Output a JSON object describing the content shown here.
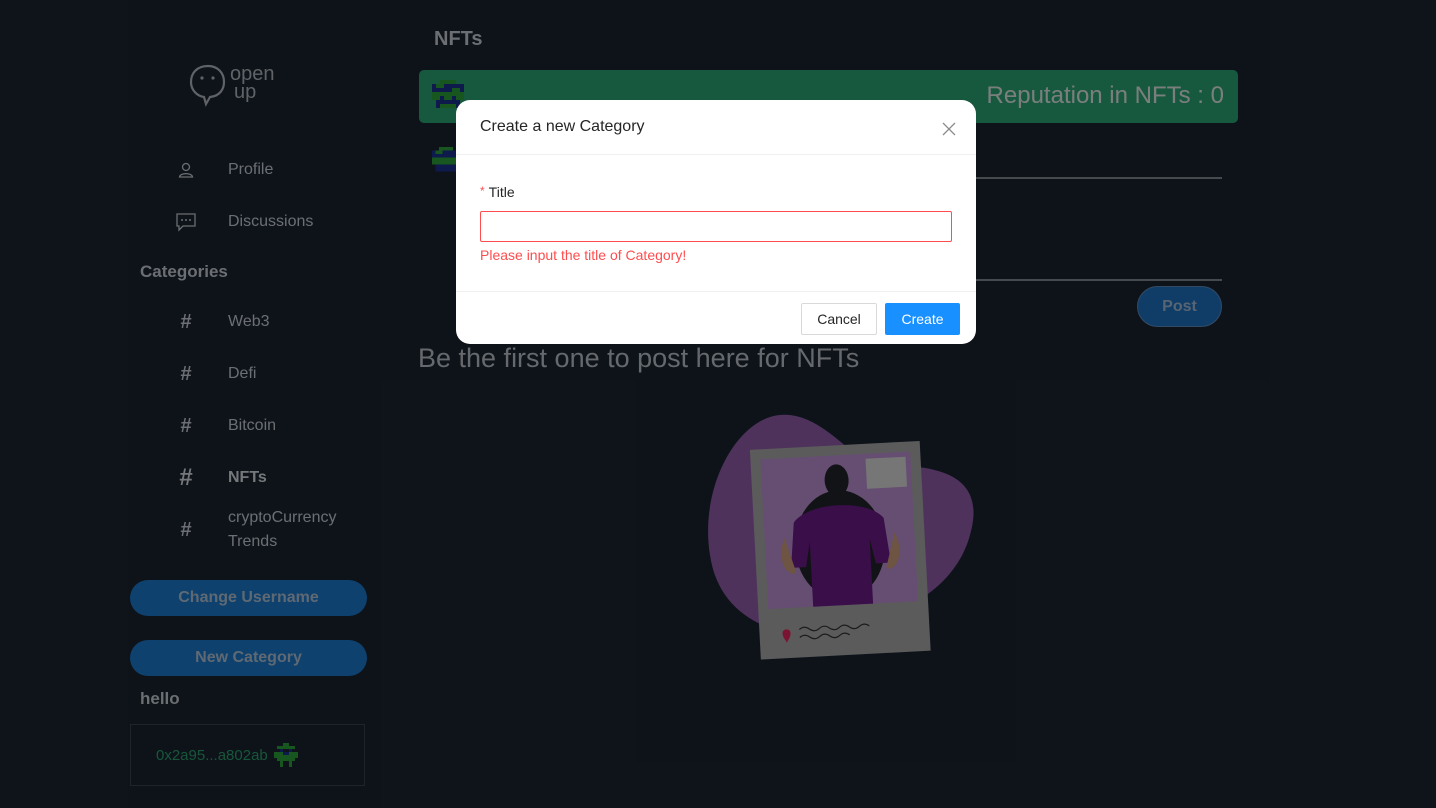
{
  "brand": {
    "logo_text_line1": "open",
    "logo_text_line2": "up"
  },
  "sidebar": {
    "nav": [
      {
        "label": "Profile",
        "icon": "user-icon"
      },
      {
        "label": "Discussions",
        "icon": "chat-icon"
      }
    ],
    "categories_title": "Categories",
    "categories": [
      {
        "label": "Web3",
        "active": false
      },
      {
        "label": "Defi",
        "active": false
      },
      {
        "label": "Bitcoin",
        "active": false
      },
      {
        "label": "NFTs",
        "active": true
      },
      {
        "label_line1": "cryptoCurrency",
        "label_line2": "Trends",
        "active": false
      }
    ],
    "change_username_label": "Change Username",
    "new_category_label": "New Category",
    "username": "hello",
    "wallet_address": "0x2a95...a802ab"
  },
  "main": {
    "title": "NFTs",
    "reputation_text": "Reputation in NFTs : 0",
    "post_button_label": "Post",
    "empty_message": "Be the first one to post here for NFTs"
  },
  "modal": {
    "title": "Create a new Category",
    "field_label": "Title",
    "required_mark": "*",
    "input_value": "",
    "error_text": "Please input the title of Category!",
    "cancel_label": "Cancel",
    "create_label": "Create"
  },
  "colors": {
    "background": "#1b2431",
    "reputation_bar": "#2aa374",
    "pill_button": "#1b77c9",
    "primary": "#1890ff",
    "error": "#ff4d4f"
  }
}
